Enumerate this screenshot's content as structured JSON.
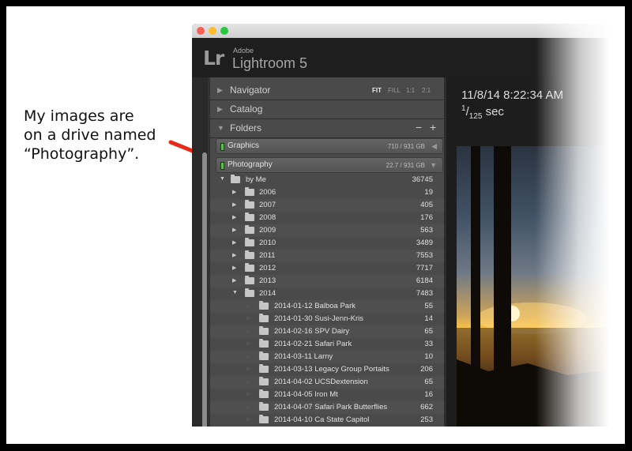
{
  "callout": {
    "line1": "My images are",
    "line2": "on a drive named",
    "line3": "“Photography”."
  },
  "colors": {
    "arrow": "#e8291c",
    "drive_led": "#5bbf4a",
    "panel_bg": "#4a4a4a"
  },
  "app": {
    "vendor": "Adobe",
    "name": "Lightroom 5",
    "logo": "Lr"
  },
  "navigator": {
    "label": "Navigator",
    "zoom_options": [
      "FIT",
      "FILL",
      "1:1",
      "2:1"
    ],
    "zoom_selected": "FIT"
  },
  "catalog": {
    "label": "Catalog"
  },
  "folders": {
    "label": "Folders",
    "minus": "−",
    "plus": "+",
    "drives": [
      {
        "name": "Graphics",
        "capacity": "710 / 931 GB"
      },
      {
        "name": "Photography",
        "capacity": "22.7 / 931 GB"
      }
    ],
    "root": {
      "name": "by Me",
      "count": "36745"
    },
    "years": [
      {
        "name": "2006",
        "count": "19"
      },
      {
        "name": "2007",
        "count": "405"
      },
      {
        "name": "2008",
        "count": "176"
      },
      {
        "name": "2009",
        "count": "563"
      },
      {
        "name": "2010",
        "count": "3489"
      },
      {
        "name": "2011",
        "count": "7553"
      },
      {
        "name": "2012",
        "count": "7717"
      },
      {
        "name": "2013",
        "count": "6184"
      },
      {
        "name": "2014",
        "count": "7483"
      }
    ],
    "subfolders": [
      {
        "name": "2014-01-12 Balboa Park",
        "count": "55"
      },
      {
        "name": "2014-01-30 Susi-Jenn-Kris",
        "count": "14"
      },
      {
        "name": "2014-02-16 SPV Dairy",
        "count": "65"
      },
      {
        "name": "2014-02-21 Safari Park",
        "count": "33"
      },
      {
        "name": "2014-03-11 Larny",
        "count": "10"
      },
      {
        "name": "2014-03-13 Legacy Group Portaits",
        "count": "206"
      },
      {
        "name": "2014-04-02 UCSDextension",
        "count": "65"
      },
      {
        "name": "2014-04-05 Iron Mt",
        "count": "16"
      },
      {
        "name": "2014-04-07 Safari Park Butterflies",
        "count": "662"
      },
      {
        "name": "2014-04-10 Ca State Capitol",
        "count": "253"
      }
    ]
  },
  "photo_info": {
    "datetime": "11/8/14 8:22:34 AM",
    "shutter_num": "1",
    "shutter_den": "125",
    "shutter_unit": "sec"
  },
  "icons": {
    "expand": "triangle-right-icon",
    "collapse": "triangle-down-icon",
    "folder": "folder-icon",
    "drive": "drive-led-icon"
  }
}
